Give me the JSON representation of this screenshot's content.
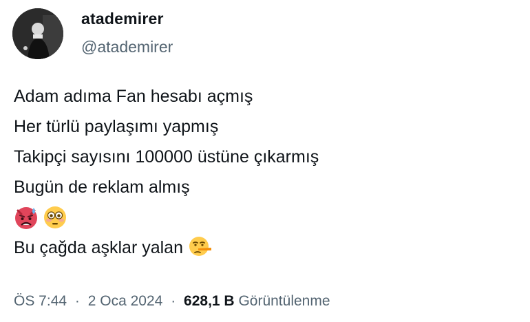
{
  "author": {
    "display_name": "atademirer",
    "handle": "@atademirer"
  },
  "tweet": {
    "lines": [
      "Adam adıma Fan hesabı açmış",
      "Her türlü paylaşımı yapmış",
      "Takipçi sayısını 100000 üstüne çıkarmış",
      "Bugün de reklam almış"
    ],
    "emoji_row": [
      "angry-face-with-sweat-emoji",
      "flushed-face-emoji"
    ],
    "last_line": "Bu çağda aşklar yalan",
    "last_line_emoji": "lying-face-emoji"
  },
  "meta": {
    "time": "ÖS 7:44",
    "date": "2 Oca 2024",
    "separator": "·",
    "views": "628,1 B",
    "views_label": "Görüntülenme"
  }
}
